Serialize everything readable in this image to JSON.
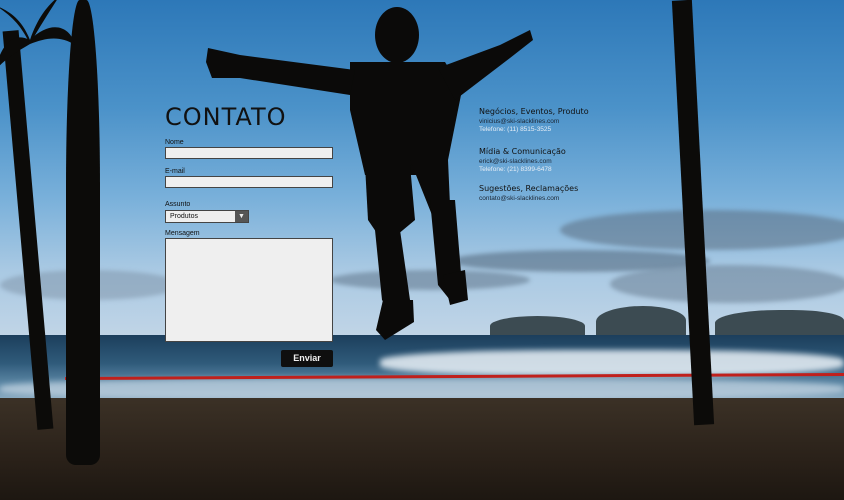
{
  "form": {
    "title": "CONTATO",
    "name_label": "Nome",
    "email_label": "E-mail",
    "subject_label": "Assunto",
    "subject_value": "Produtos",
    "message_label": "Mensagem",
    "send_label": "Enviar"
  },
  "contacts": [
    {
      "heading": "Negócios, Eventos, Produto",
      "email": "vinicius@ski-slacklines.com",
      "phone": "Telefone: (11) 8515-3525"
    },
    {
      "heading": "Mídia & Comunicação",
      "email": "erick@ski-slacklines.com",
      "phone": "Telefone: (21) 8399-6478"
    },
    {
      "heading": "Sugestões, Reclamações",
      "email": "contato@ski-slacklines.com"
    }
  ],
  "icons": {
    "select_arrow": "triangle-down-icon"
  },
  "colors": {
    "rope": "#c0201c",
    "field_bg": "#efefef",
    "button_bg": "#0f0f0f"
  }
}
